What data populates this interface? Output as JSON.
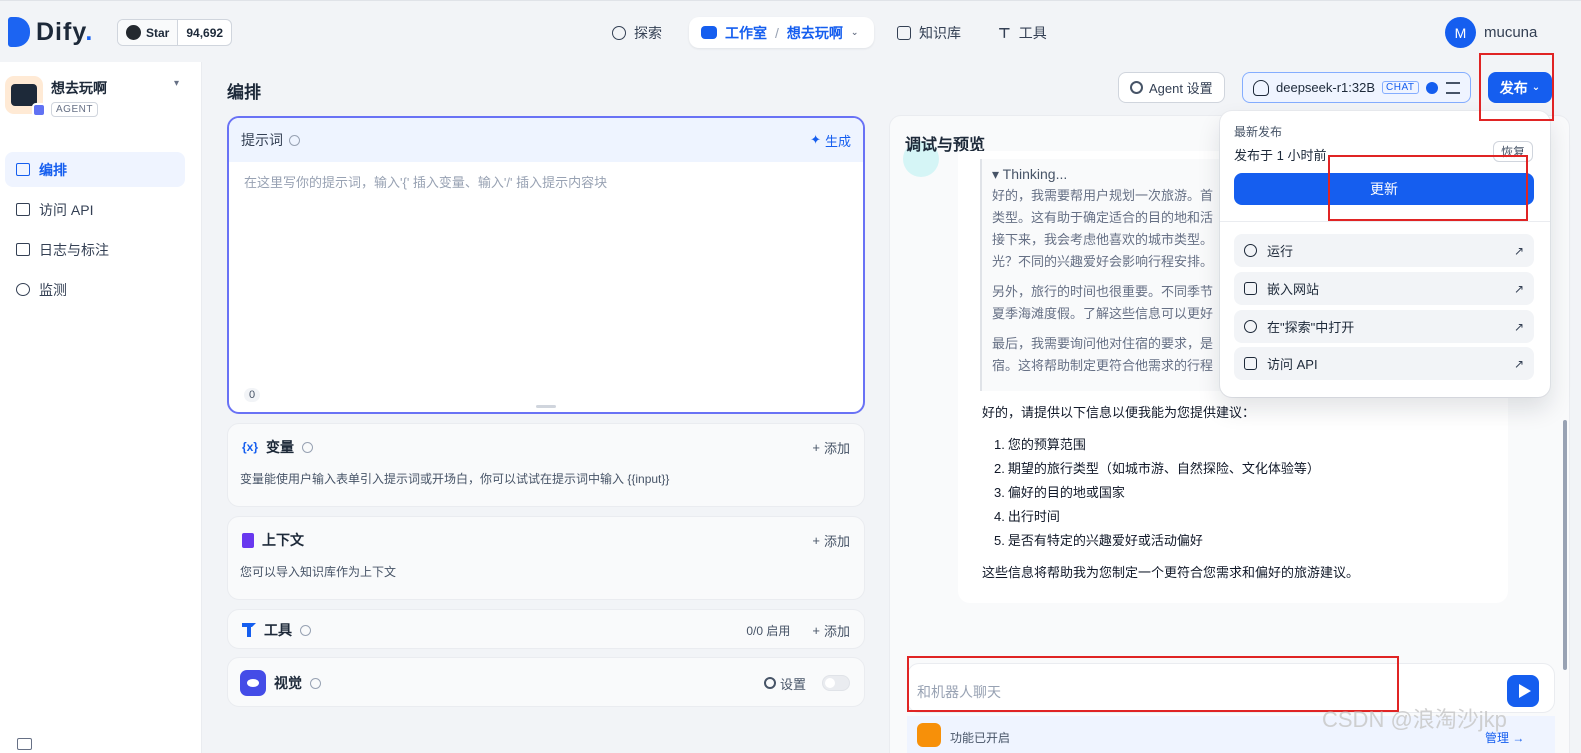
{
  "brand": {
    "name": "Dify",
    "dot": "."
  },
  "github": {
    "star_label": "Star",
    "star_count": "94,692"
  },
  "nav": {
    "explore": "探索",
    "studio": "工作室",
    "separator": "/",
    "current_app": "想去玩啊",
    "knowledge": "知识库",
    "tools": "工具"
  },
  "user": {
    "initial": "M",
    "name": "mucuna"
  },
  "app": {
    "name": "想去玩啊",
    "type": "AGENT"
  },
  "sidebar": {
    "items": [
      {
        "label": "编排",
        "icon": "layout-icon"
      },
      {
        "label": "访问 API",
        "icon": "terminal-icon"
      },
      {
        "label": "日志与标注",
        "icon": "file-icon"
      },
      {
        "label": "监测",
        "icon": "gauge-icon"
      }
    ]
  },
  "main": {
    "title": "编排",
    "agent_settings": "Agent 设置",
    "model": {
      "name": "deepseek-r1:32B",
      "tag": "CHAT"
    },
    "publish": "发布"
  },
  "prompt": {
    "title": "提示词",
    "generate": "生成",
    "placeholder": "在这里写你的提示词，输入'{' 插入变量、输入'/' 插入提示内容块",
    "count": "0"
  },
  "variables": {
    "icon": "{x}",
    "title": "变量",
    "add": "添加",
    "desc": "变量能使用户输入表单引入提示词或开场白，你可以试试在提示词中输入 {{input}}"
  },
  "context": {
    "title": "上下文",
    "add": "添加",
    "desc": "您可以导入知识库作为上下文"
  },
  "tools": {
    "title": "工具",
    "count": "0/0 启用",
    "add": "添加"
  },
  "vision": {
    "title": "视觉",
    "settings": "设置"
  },
  "debug": {
    "title": "调试与预览",
    "thinking_head": "▾ Thinking...",
    "thinking": [
      "好的，我需要帮用户规划一次旅游。首",
      "类型。这有助于确定适合的目的地和活",
      "接下来，我会考虑他喜欢的城市类型。",
      "光？不同的兴趣爱好会影响行程安排。",
      "另外，旅行的时间也很重要。不同季节",
      "夏季海滩度假。了解这些信息可以更好",
      "最后，我需要询问他对住宿的要求，是",
      "宿。这将帮助制定更符合他需求的行程"
    ],
    "answer_intro": "好的，请提供以下信息以便我能为您提供建议：",
    "answer_items": [
      "您的预算范围",
      "期望的旅行类型（如城市游、自然探险、文化体验等）",
      "偏好的目的地或国家",
      "出行时间",
      "是否有特定的兴趣爱好或活动偏好"
    ],
    "answer_closing": "这些信息将帮助我为您制定一个更符合您需求和偏好的旅游建议。",
    "input_placeholder": "和机器人聊天",
    "features_enabled": "功能已开启",
    "manage": "管理 →"
  },
  "publish_menu": {
    "latest_label": "最新发布",
    "published_time": "发布于 1 小时前",
    "restore": "恢复",
    "update": "更新",
    "items": [
      {
        "label": "运行",
        "icon": "play-icon"
      },
      {
        "label": "嵌入网站",
        "icon": "embed-icon"
      },
      {
        "label": "在\"探索\"中打开",
        "icon": "compass-icon"
      },
      {
        "label": "访问 API",
        "icon": "doc-icon"
      }
    ]
  },
  "watermark": "CSDN @浪淘沙jkp",
  "colors": {
    "accent": "#155eef",
    "annotation": "#e02424"
  }
}
